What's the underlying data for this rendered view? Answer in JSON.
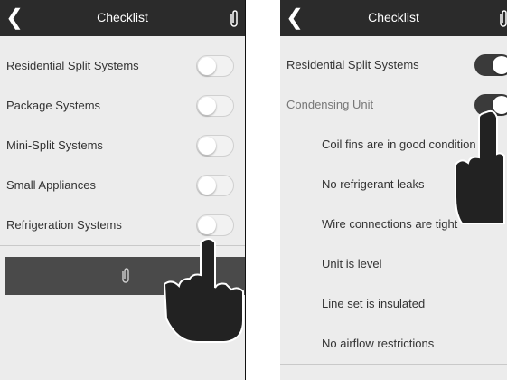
{
  "left": {
    "header": {
      "title": "Checklist"
    },
    "items": [
      {
        "label": "Residential Split Systems",
        "on": false
      },
      {
        "label": "Package Systems",
        "on": false
      },
      {
        "label": "Mini-Split Systems",
        "on": false
      },
      {
        "label": "Small Appliances",
        "on": false
      },
      {
        "label": "Refrigeration Systems",
        "on": false
      }
    ]
  },
  "right": {
    "header": {
      "title": "Checklist"
    },
    "items": [
      {
        "label": "Residential Split Systems",
        "on": true
      },
      {
        "label": "Condensing Unit",
        "on": true
      },
      {
        "label": "Coil fins are in good condition"
      },
      {
        "label": "No refrigerant leaks"
      },
      {
        "label": "Wire connections are tight"
      },
      {
        "label": "Unit is level"
      },
      {
        "label": "Line set is insulated"
      },
      {
        "label": "No airflow restrictions"
      }
    ]
  },
  "icons": {
    "back": "chevron-left-icon",
    "attach": "paperclip-icon",
    "pointer": "pointing-hand-icon"
  },
  "colors": {
    "header": "#2b2b2b",
    "toggle_on": "#3a3a3a",
    "background": "#ececec"
  }
}
